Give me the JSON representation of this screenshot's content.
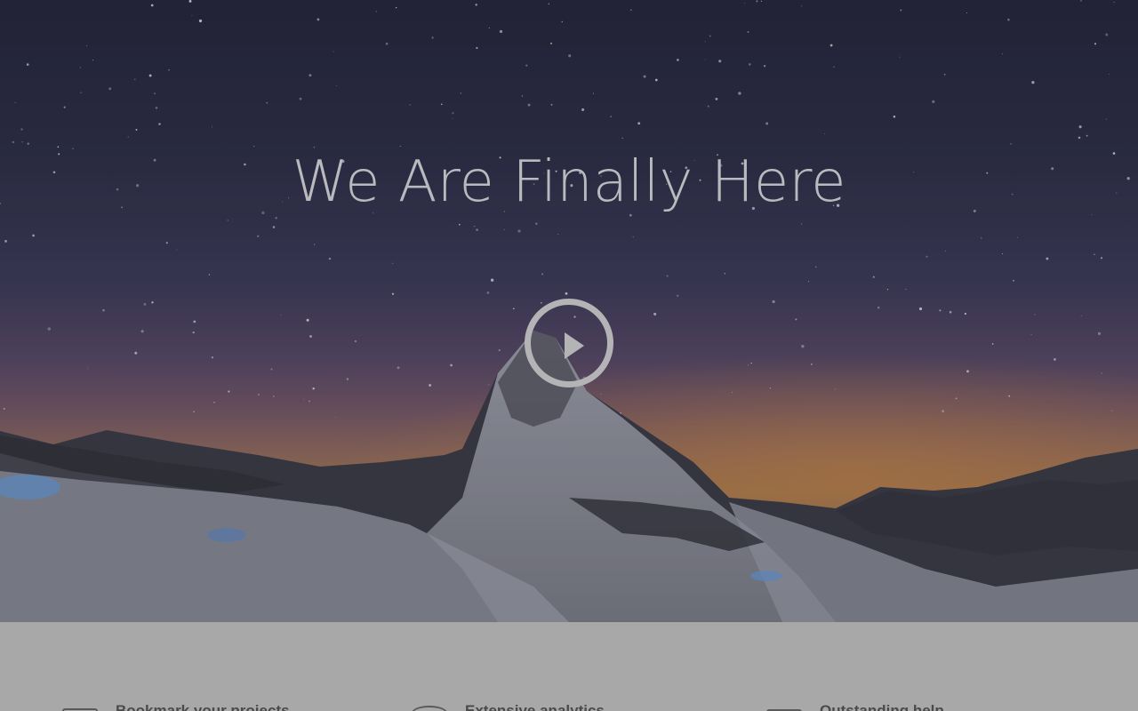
{
  "hero": {
    "title": "We Are Finally Here",
    "play_icon": "play-icon"
  },
  "features": [
    {
      "icon": "bookmark-icon",
      "title": "Bookmark your projects"
    },
    {
      "icon": "analytics-icon",
      "title": "Extensive analytics"
    },
    {
      "icon": "help-icon",
      "title": "Outstanding help"
    }
  ],
  "colors": {
    "title_text": "#b9b9be",
    "play_button": "#b4b4b6",
    "features_background": "#a8a8a8",
    "feature_text": "#4a4a4a"
  }
}
